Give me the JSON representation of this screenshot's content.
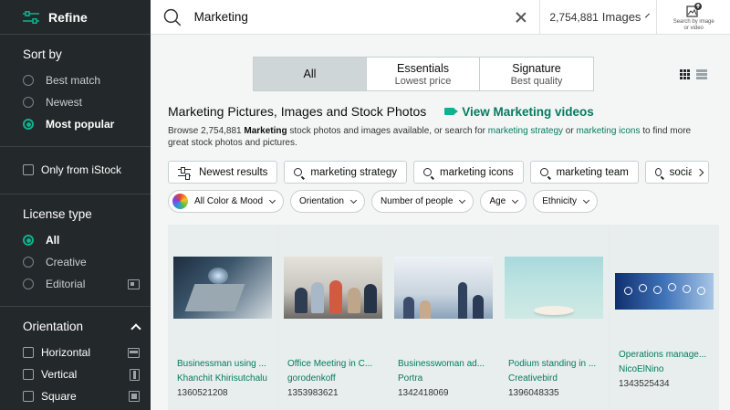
{
  "sidebar": {
    "refine_label": "Refine",
    "sort": {
      "title": "Sort by",
      "options": [
        {
          "label": "Best match",
          "selected": false
        },
        {
          "label": "Newest",
          "selected": false
        },
        {
          "label": "Most popular",
          "selected": true
        }
      ]
    },
    "only_istock_label": "Only from iStock",
    "license": {
      "title": "License type",
      "options": [
        {
          "label": "All",
          "selected": true
        },
        {
          "label": "Creative",
          "selected": false
        },
        {
          "label": "Editorial",
          "selected": false
        }
      ]
    },
    "orientation": {
      "title": "Orientation",
      "options": [
        "Horizontal",
        "Vertical",
        "Square"
      ]
    }
  },
  "search": {
    "value": "Marketing",
    "result_count": "2,754,881",
    "type_label": "Images",
    "image_search_line1": "Search by image",
    "image_search_line2": "or video"
  },
  "tabs": [
    {
      "label": "All",
      "sub": "",
      "active": true
    },
    {
      "label": "Essentials",
      "sub": "Lowest price",
      "active": false
    },
    {
      "label": "Signature",
      "sub": "Best quality",
      "active": false
    }
  ],
  "heading": {
    "title": "Marketing Pictures, Images and Stock Photos",
    "video_link": "View Marketing videos"
  },
  "description": {
    "part1": "Browse 2,754,881 ",
    "keyword": "Marketing",
    "part2": " stock photos and images available, or search for ",
    "link1": "marketing strategy",
    "part3": " or ",
    "link2": "marketing icons",
    "part4": " to find more great stock photos and pictures."
  },
  "chips": {
    "newest": "Newest results",
    "related": [
      "marketing strategy",
      "marketing icons",
      "marketing team",
      "social m"
    ]
  },
  "filters": {
    "color": "All Color & Mood",
    "items": [
      "Orientation",
      "Number of people",
      "Age",
      "Ethnicity"
    ]
  },
  "results": [
    {
      "title": "Businessman using ...",
      "author": "Khanchit Khirisutchalu",
      "id": "1360521208"
    },
    {
      "title": "Office Meeting in C...",
      "author": "gorodenkoff",
      "id": "1353983621"
    },
    {
      "title": "Businesswoman ad...",
      "author": "Portra",
      "id": "1342418069"
    },
    {
      "title": "Podium standing in ...",
      "author": "Creativebird",
      "id": "1396048335"
    },
    {
      "title": "Operations manage...",
      "author": "NicoElNino",
      "id": "1343525434"
    }
  ],
  "colors": {
    "sidebar_bg": "#23282a",
    "accent": "#0fb28f",
    "link": "#067a5e"
  }
}
